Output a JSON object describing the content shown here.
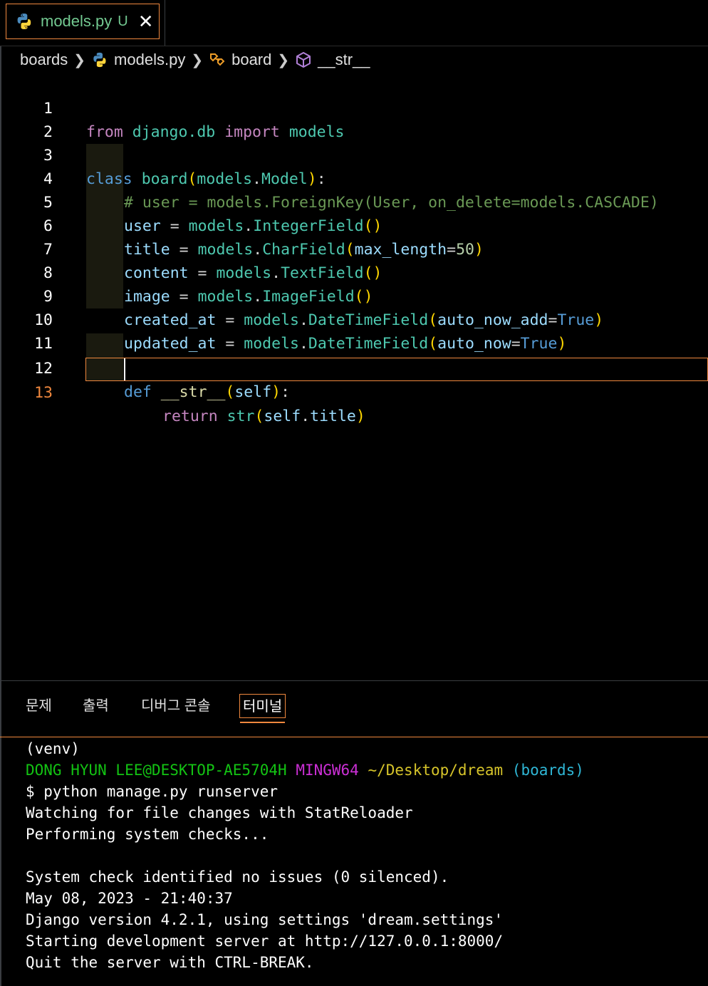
{
  "tab": {
    "filename": "models.py",
    "status": "U",
    "close": "✕"
  },
  "breadcrumb": {
    "items": [
      "boards",
      "models.py",
      "board",
      "__str__"
    ]
  },
  "editor": {
    "line_numbers": [
      "1",
      "2",
      "3",
      "4",
      "5",
      "6",
      "7",
      "8",
      "9",
      "10",
      "11",
      "12",
      "13"
    ],
    "active_line": "13",
    "lines": {
      "l1": {
        "from": "from",
        "mod": "django.db",
        "import": "import",
        "name": "models"
      },
      "l3": {
        "class": "class",
        "name": "board",
        "open": "(",
        "base1": "models",
        "dot": ".",
        "base2": "Model",
        "close": ")",
        "colon": ":"
      },
      "l4": {
        "comment": "# user = models.ForeignKey(User, on_delete=models.CASCADE)"
      },
      "l5": {
        "var": "user",
        "eq": " = ",
        "mod": "models",
        "dot": ".",
        "fn": "IntegerField",
        "par": "()"
      },
      "l6": {
        "var": "title",
        "eq": " = ",
        "mod": "models",
        "dot": ".",
        "fn": "CharField",
        "open": "(",
        "kw": "max_length",
        "eq2": "=",
        "num": "50",
        "close": ")"
      },
      "l7": {
        "var": "content",
        "eq": " = ",
        "mod": "models",
        "dot": ".",
        "fn": "TextField",
        "par": "()"
      },
      "l8": {
        "var": "image",
        "eq": " = ",
        "mod": "models",
        "dot": ".",
        "fn": "ImageField",
        "par": "()"
      },
      "l9": {
        "var": "created_at",
        "eq": " = ",
        "mod": "models",
        "dot": ".",
        "fn": "DateTimeField",
        "open": "(",
        "kw": "auto_now_add",
        "eq2": "=",
        "val": "True",
        "close": ")"
      },
      "l10": {
        "var": "updated_at",
        "eq": " = ",
        "mod": "models",
        "dot": ".",
        "fn": "DateTimeField",
        "open": "(",
        "kw": "auto_now",
        "eq2": "=",
        "val": "True",
        "close": ")"
      },
      "l12": {
        "def": "def",
        "name": "__str__",
        "open": "(",
        "self": "self",
        "close": ")",
        "colon": ":"
      },
      "l13": {
        "ret": "return",
        "fn": "str",
        "open": "(",
        "self": "self",
        "dot": ".",
        "attr": "title",
        "close": ")"
      }
    }
  },
  "panel": {
    "tabs": [
      "문제",
      "출력",
      "디버그 콘솔",
      "터미널"
    ],
    "active_tab": "터미널"
  },
  "terminal": {
    "venv": "(venv)",
    "prompt_user": "DONG HYUN LEE@DESKTOP-AE5704H",
    "prompt_shell": "MINGW64",
    "prompt_path": "~/Desktop/dream",
    "prompt_branch": "(boards)",
    "lines": [
      "$ python manage.py runserver",
      "Watching for file changes with StatReloader",
      "Performing system checks...",
      "",
      "System check identified no issues (0 silenced).",
      "May 08, 2023 - 21:40:37",
      "Django version 4.2.1, using settings 'dream.settings'",
      "Starting development server at http://127.0.0.1:8000/",
      "Quit the server with CTRL-BREAK."
    ]
  },
  "colors": {
    "accent": "#f0883e",
    "tab_text": "#73c991"
  }
}
